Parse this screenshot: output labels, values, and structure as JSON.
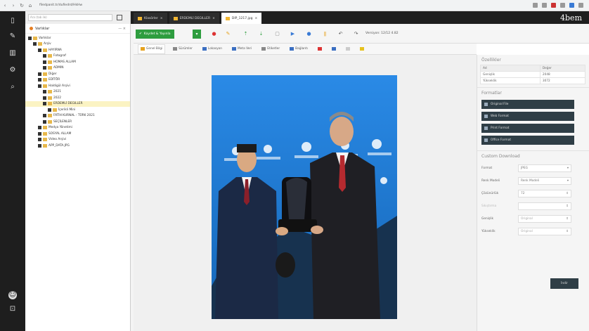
{
  "browser": {
    "url": "filedpanit.tr/dufiedrd/HkHw"
  },
  "search": {
    "placeholder": "Ara (tab ile)"
  },
  "tabs": [
    {
      "label": "Klasörler"
    },
    {
      "label": "ERDEMLİ DEGILLER"
    },
    {
      "label": "DIP_1217.jpg"
    }
  ],
  "logo": "4bem",
  "tree": {
    "title": "Varlıklar",
    "controls": "— ×",
    "nodes": [
      {
        "label": "Varlıklar",
        "depth": 0
      },
      {
        "label": "Arşiv",
        "depth": 1
      },
      {
        "label": "HAYIRNA",
        "depth": 2
      },
      {
        "label": "Fotograf",
        "depth": 3
      },
      {
        "label": "HOMAS ALLAM",
        "depth": 3
      },
      {
        "label": "ADMIN",
        "depth": 3
      },
      {
        "label": "Diğer",
        "depth": 2
      },
      {
        "label": "EDİTÖR",
        "depth": 2
      },
      {
        "label": "Haldigül Arşivi",
        "depth": 2
      },
      {
        "label": "2021",
        "depth": 3
      },
      {
        "label": "2022",
        "depth": 3
      },
      {
        "label": "ERDEMLİ DEGILLER",
        "depth": 3,
        "selected": true
      },
      {
        "label": "İçerikli Mini",
        "depth": 4
      },
      {
        "label": "FATİH KURNAL - TÜRK 2021",
        "depth": 3
      },
      {
        "label": "SEÇİLENLER",
        "depth": 3
      },
      {
        "label": "Medya Yönetimi",
        "depth": 2
      },
      {
        "label": "SOSYAL ALLAM",
        "depth": 2
      },
      {
        "label": "Video Arşivi",
        "depth": 2
      },
      {
        "label": "APP_DATA.JPG",
        "depth": 2
      }
    ]
  },
  "toolbar": {
    "save_label": "Kaydet & Yayınla",
    "status_text": "Versiyon: 12/12 4.82"
  },
  "subtabs": [
    {
      "label": "Genel Bilgi"
    },
    {
      "label": "Sürümler"
    },
    {
      "label": "Lokasyon"
    },
    {
      "label": "Meta Veri"
    },
    {
      "label": "Etiketler"
    },
    {
      "label": "Bağlantı"
    }
  ],
  "properties": {
    "title": "Özellikler",
    "headers": [
      "Ad",
      "Değer"
    ],
    "rows": [
      {
        "key": "Genişlik",
        "value": "2048"
      },
      {
        "key": "Yükseklik",
        "value": "3072"
      }
    ]
  },
  "formats": {
    "title": "Formatlar",
    "items": [
      {
        "label": "Original File"
      },
      {
        "label": "Web Format"
      },
      {
        "label": "Print Format"
      },
      {
        "label": "Office Format"
      }
    ]
  },
  "custom_download": {
    "title": "Custom Download",
    "fields": [
      {
        "label": "Format",
        "value": "JPEG"
      },
      {
        "label": "Renk Modeli",
        "value": "Renk Modeli"
      },
      {
        "label": "Çözünürlük",
        "value": "72"
      },
      {
        "label": "Sıkıştırma",
        "value": ""
      },
      {
        "label": "Genişlik",
        "value": "Original"
      },
      {
        "label": "Yükseklik",
        "value": "Original"
      }
    ],
    "download_label": "İndir"
  },
  "colors": {
    "accent": "#2e9d3f",
    "dark": "#1e1e1e",
    "folder": "#e8b84a"
  }
}
